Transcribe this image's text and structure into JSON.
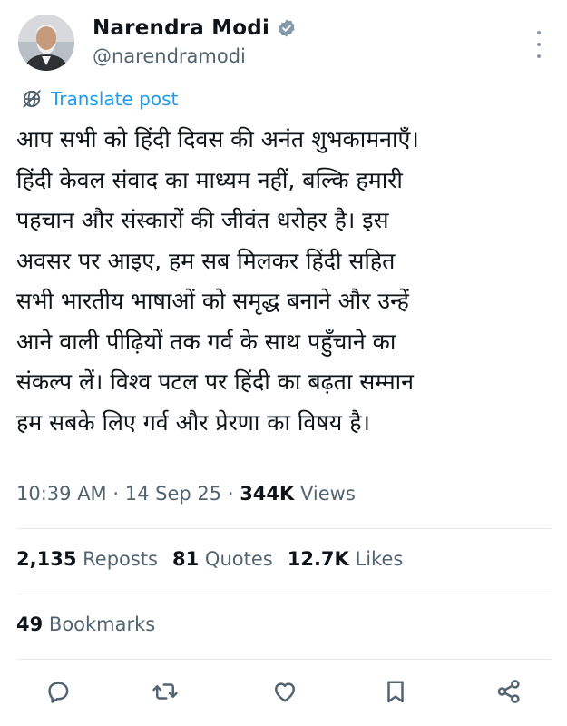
{
  "author": {
    "display_name": "Narendra Modi",
    "handle": "@narendramodi"
  },
  "translate_label": "Translate post",
  "tweet_lines": [
    "आप सभी को हिंदी दिवस की अनंत शुभकामनाएँ।",
    "हिंदी केवल संवाद का माध्यम नहीं, बल्कि हमारी",
    "पहचान और संस्कारों की जीवंत धरोहर है। इस",
    "अवसर पर आइए, हम सब मिलकर हिंदी सहित",
    "सभी भारतीय भाषाओं को समृद्ध बनाने और उन्हें",
    "आने वाली पीढ़ियों तक गर्व के साथ पहुँचाने का",
    "संकल्प लें। विश्व पटल पर हिंदी का बढ़ता सम्मान",
    "हम सबके लिए गर्व और प्रेरणा का विषय है।"
  ],
  "meta": {
    "time": "10:39 AM",
    "separator": "·",
    "date": "14 Sep 25",
    "views_count": "344K",
    "views_label": "Views"
  },
  "stats": {
    "reposts_count": "2,135",
    "reposts_label": "Reposts",
    "quotes_count": "81",
    "quotes_label": "Quotes",
    "likes_count": "12.7K",
    "likes_label": "Likes",
    "bookmarks_count": "49",
    "bookmarks_label": "Bookmarks"
  },
  "icons": {
    "verified": "verified-badge-icon",
    "translate": "translate-globe-icon",
    "reply": "reply-icon",
    "repost": "repost-icon",
    "like": "heart-icon",
    "bookmark": "bookmark-icon",
    "share": "share-icon",
    "more": "more-vertical-icon"
  },
  "colors": {
    "accent": "#1d9bf0",
    "text": "#0f1419",
    "muted": "#536471"
  }
}
